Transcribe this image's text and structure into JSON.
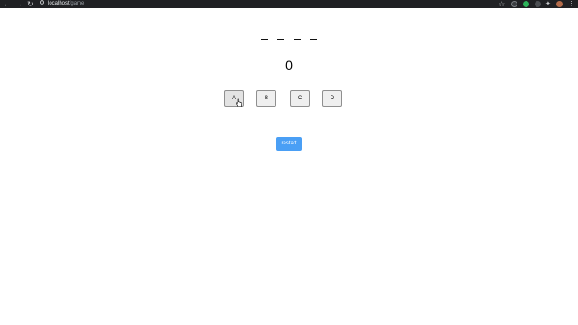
{
  "browser": {
    "url_host": "localhost",
    "url_path": "/game"
  },
  "game": {
    "slots": [
      "",
      "",
      "",
      ""
    ],
    "score": "0",
    "letters": [
      "A",
      "B",
      "C",
      "D"
    ],
    "restart_label": "restart"
  },
  "colors": {
    "restart_bg": "#4a9ff5",
    "chrome_bg": "#202124"
  }
}
